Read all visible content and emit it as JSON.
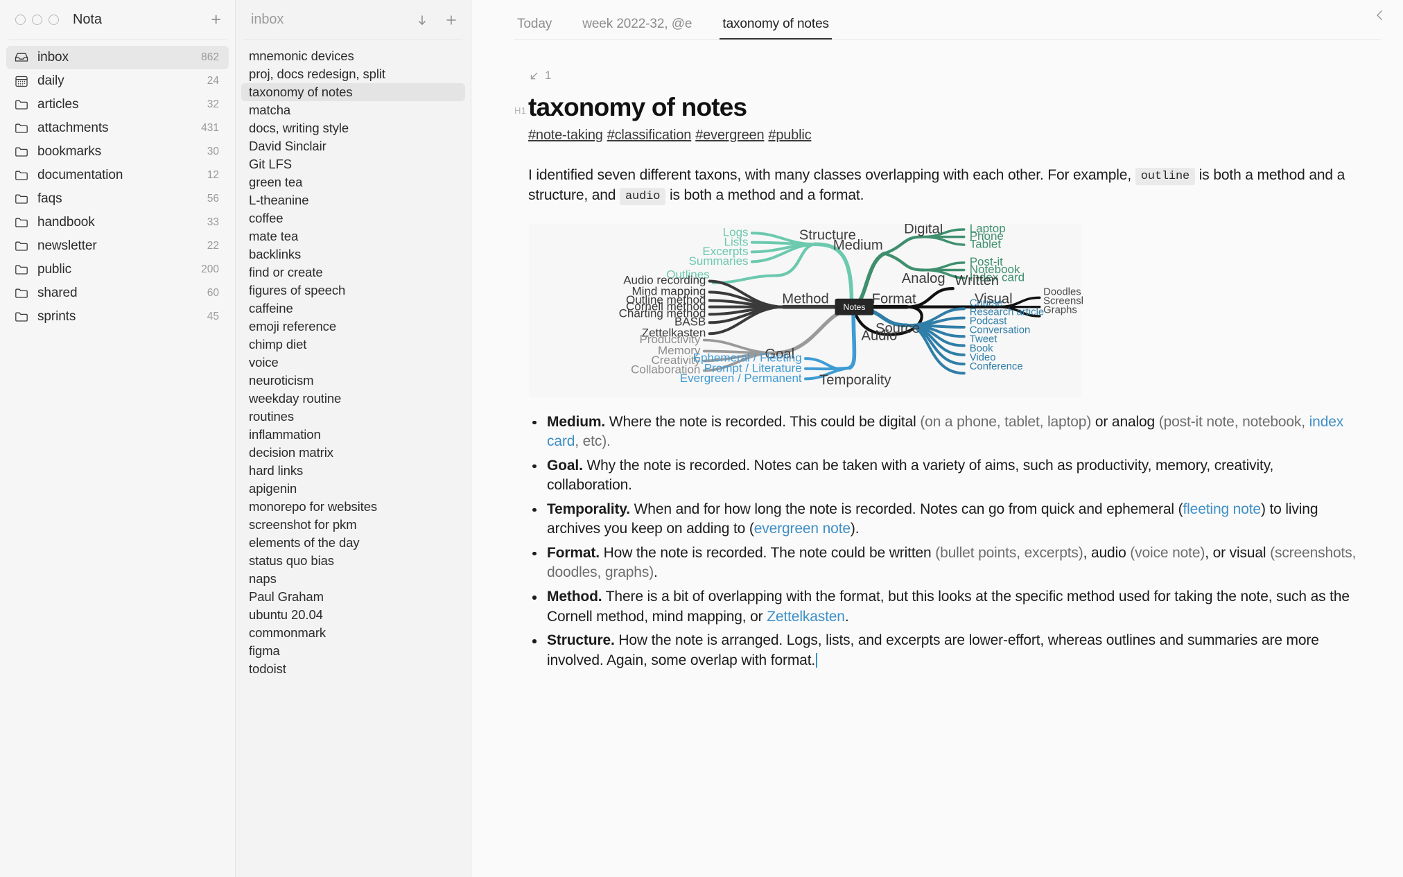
{
  "window": {
    "app_title": "Nota",
    "add_button": "+",
    "traffic_lights": [
      "close",
      "minimize",
      "zoom"
    ]
  },
  "sidebar": {
    "items": [
      {
        "label": "inbox",
        "count": "862",
        "icon": "inbox-icon",
        "active": true
      },
      {
        "label": "daily",
        "count": "24",
        "icon": "calendar-icon",
        "active": false
      },
      {
        "label": "articles",
        "count": "32",
        "icon": "folder-icon",
        "active": false
      },
      {
        "label": "attachments",
        "count": "431",
        "icon": "folder-icon",
        "active": false
      },
      {
        "label": "bookmarks",
        "count": "30",
        "icon": "folder-icon",
        "active": false
      },
      {
        "label": "documentation",
        "count": "12",
        "icon": "folder-icon",
        "active": false
      },
      {
        "label": "faqs",
        "count": "56",
        "icon": "folder-icon",
        "active": false
      },
      {
        "label": "handbook",
        "count": "33",
        "icon": "folder-icon",
        "active": false
      },
      {
        "label": "newsletter",
        "count": "22",
        "icon": "folder-icon",
        "active": false
      },
      {
        "label": "public",
        "count": "200",
        "icon": "folder-icon",
        "active": false
      },
      {
        "label": "shared",
        "count": "60",
        "icon": "folder-icon",
        "active": false
      },
      {
        "label": "sprints",
        "count": "45",
        "icon": "folder-icon",
        "active": false
      }
    ]
  },
  "notelist": {
    "title": "inbox",
    "sort_icon": "arrow-down-icon",
    "add_icon": "plus-icon",
    "items": [
      {
        "label": "mnemonic devices",
        "active": false
      },
      {
        "label": "proj, docs redesign, split",
        "active": false
      },
      {
        "label": "taxonomy of notes",
        "active": true
      },
      {
        "label": "matcha",
        "active": false
      },
      {
        "label": "docs, writing style",
        "active": false
      },
      {
        "label": "David Sinclair",
        "active": false
      },
      {
        "label": "Git LFS",
        "active": false
      },
      {
        "label": "green tea",
        "active": false
      },
      {
        "label": "L-theanine",
        "active": false
      },
      {
        "label": "coffee",
        "active": false
      },
      {
        "label": "mate tea",
        "active": false
      },
      {
        "label": "backlinks",
        "active": false
      },
      {
        "label": "find or create",
        "active": false
      },
      {
        "label": "figures of speech",
        "active": false
      },
      {
        "label": "caffeine",
        "active": false
      },
      {
        "label": "emoji reference",
        "active": false
      },
      {
        "label": "chimp diet",
        "active": false
      },
      {
        "label": "voice",
        "active": false
      },
      {
        "label": "neuroticism",
        "active": false
      },
      {
        "label": "weekday routine",
        "active": false
      },
      {
        "label": "routines",
        "active": false
      },
      {
        "label": "inflammation",
        "active": false
      },
      {
        "label": "decision matrix",
        "active": false
      },
      {
        "label": "hard links",
        "active": false
      },
      {
        "label": "apigenin",
        "active": false
      },
      {
        "label": "monorepo for websites",
        "active": false
      },
      {
        "label": "screenshot for pkm",
        "active": false
      },
      {
        "label": "elements of the day",
        "active": false
      },
      {
        "label": "status quo bias",
        "active": false
      },
      {
        "label": "naps",
        "active": false
      },
      {
        "label": "Paul Graham",
        "active": false
      },
      {
        "label": "ubuntu 20.04",
        "active": false
      },
      {
        "label": "commonmark",
        "active": false
      },
      {
        "label": "figma",
        "active": false
      },
      {
        "label": "todoist",
        "active": false
      }
    ]
  },
  "editor": {
    "tabs": [
      {
        "label": "Today",
        "active": false
      },
      {
        "label": "week 2022-32, @e",
        "active": false
      },
      {
        "label": "taxonomy of notes",
        "active": true
      }
    ],
    "collapse_icon": "chevron-left-icon",
    "backlink": {
      "icon": "arrow-down-left-icon",
      "count": "1"
    },
    "heading_marker": "H1",
    "title": "taxonomy of notes",
    "tags": [
      "#note-taking",
      "#classification",
      "#evergreen",
      "#public"
    ],
    "paragraph": {
      "p1": "I identified seven different taxons, with many classes overlapping with each other. For example,",
      "code1": "outline",
      "p2": "is both a method and a structure, and",
      "code2": "audio",
      "p3": "is both a method and a format."
    },
    "bullets": [
      {
        "term": "Medium.",
        "parts": [
          {
            "t": " Where the note is recorded. This could be digital ",
            "s": "plain"
          },
          {
            "t": "(on a phone, tablet, laptop)",
            "s": "muted"
          },
          {
            "t": " or analog ",
            "s": "plain"
          },
          {
            "t": "(post-it note, notebook, ",
            "s": "muted"
          },
          {
            "t": "index card",
            "s": "link"
          },
          {
            "t": ", etc).",
            "s": "muted"
          }
        ]
      },
      {
        "term": "Goal.",
        "parts": [
          {
            "t": " Why the note is recorded. Notes can be taken with a variety of aims, such as productivity, memory, creativity, collaboration.",
            "s": "plain"
          }
        ]
      },
      {
        "term": "Temporality.",
        "parts": [
          {
            "t": " When and for how long the note is recorded. Notes can go from quick and ephemeral (",
            "s": "plain"
          },
          {
            "t": "fleeting note",
            "s": "link"
          },
          {
            "t": ") to living archives you keep on adding to (",
            "s": "plain"
          },
          {
            "t": "evergreen note",
            "s": "link"
          },
          {
            "t": ").",
            "s": "plain"
          }
        ]
      },
      {
        "term": "Format.",
        "parts": [
          {
            "t": " How the note is recorded. The note could be written ",
            "s": "plain"
          },
          {
            "t": "(bullet points, excerpts)",
            "s": "muted"
          },
          {
            "t": ", audio ",
            "s": "plain"
          },
          {
            "t": "(voice note)",
            "s": "muted"
          },
          {
            "t": ", or visual ",
            "s": "plain"
          },
          {
            "t": "(screenshots, doodles, graphs)",
            "s": "muted"
          },
          {
            "t": ".",
            "s": "plain"
          }
        ]
      },
      {
        "term": "Method.",
        "parts": [
          {
            "t": " There is a bit of overlapping with the format, but this looks at the specific method used for taking the note, such as the Cornell method, mind mapping, or ",
            "s": "plain"
          },
          {
            "t": "Zettelkasten",
            "s": "link"
          },
          {
            "t": ".",
            "s": "plain"
          }
        ]
      },
      {
        "term": "Structure.",
        "parts": [
          {
            "t": " How the note is arranged. Logs, lists, and excerpts are lower-effort, whereas outlines and summaries are more involved. Again, some overlap with format.",
            "s": "plain"
          }
        ]
      }
    ]
  },
  "mindmap": {
    "type": "mindmap",
    "root": "Notes",
    "colors": {
      "structure": "#6cc9ae",
      "medium": "#3f8f6e",
      "source": "#2f7ea8",
      "temporality": "#3f9bd4",
      "goal": "#8d8d8d",
      "method": "#3a3a3a",
      "format": "#111111"
    },
    "branches": [
      {
        "name": "Structure",
        "children": [
          "Logs",
          "Lists",
          "Excerpts",
          "Summaries",
          "Outlines"
        ]
      },
      {
        "name": "Medium",
        "children": [
          {
            "name": "Digital",
            "children": [
              "Laptop",
              "Phone",
              "Tablet"
            ]
          },
          {
            "name": "Analog",
            "children": [
              "Post-it",
              "Notebook",
              "Index card"
            ]
          }
        ]
      },
      {
        "name": "Method",
        "children": [
          "Audio recording",
          "Mind mapping",
          "Outline method",
          "Cornell method",
          "Charting method",
          "BASB",
          "Zettelkasten"
        ]
      },
      {
        "name": "Format",
        "children": [
          {
            "name": "Written",
            "children": []
          },
          {
            "name": "Visual",
            "children": [
              "Doodles",
              "Screenshots",
              "Graphs"
            ]
          },
          {
            "name": "Audio",
            "children": []
          }
        ]
      },
      {
        "name": "Source",
        "children": [
          "Course",
          "Research article",
          "Podcast",
          "Conversation",
          "Tweet",
          "Book",
          "Video",
          "Conference"
        ]
      },
      {
        "name": "Goal",
        "children": [
          "Productivity",
          "Memory",
          "Creativity",
          "Collaboration"
        ]
      },
      {
        "name": "Temporality",
        "children": [
          "Ephemeral / Fleeting",
          "Prompt / Literature",
          "Evergreen / Permanent"
        ]
      }
    ]
  }
}
